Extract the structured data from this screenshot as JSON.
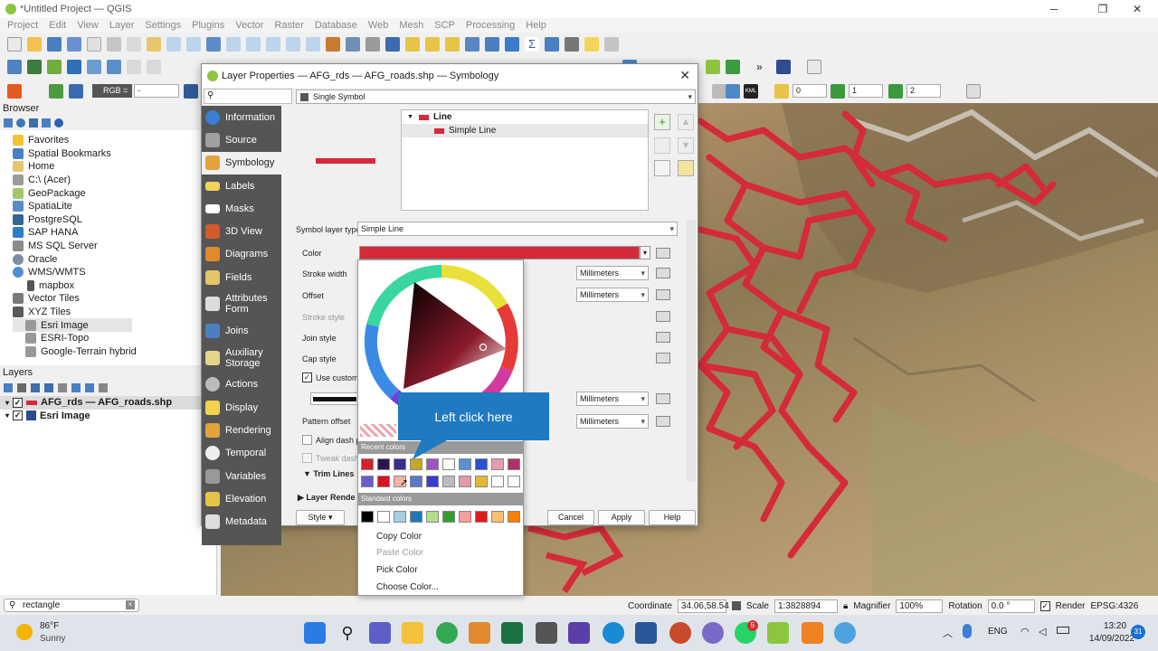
{
  "window": {
    "title": "*Untitled Project — QGIS"
  },
  "menu": [
    "Project",
    "Edit",
    "View",
    "Layer",
    "Settings",
    "Plugins",
    "Vector",
    "Raster",
    "Database",
    "Web",
    "Mesh",
    "SCP",
    "Processing",
    "Help"
  ],
  "toolbar3": {
    "rgb_label": "RGB =",
    "rgb_value": "-",
    "spin1": "0",
    "spin2": "1",
    "spin3": "2"
  },
  "browser": {
    "title": "Browser",
    "items": [
      "Favorites",
      "Spatial Bookmarks",
      "Home",
      "C:\\ (Acer)",
      "GeoPackage",
      "SpatiaLite",
      "PostgreSQL",
      "SAP HANA",
      "MS SQL Server",
      "Oracle",
      "WMS/WMTS",
      "mapbox",
      "Vector Tiles",
      "XYZ Tiles",
      "Esri Image",
      "ESRI-Topo",
      "Google-Terrain hybrid"
    ]
  },
  "layers": {
    "title": "Layers",
    "items": [
      "AFG_rds — AFG_roads.shp",
      "Esri Image"
    ]
  },
  "search": {
    "value": "rectangle"
  },
  "status": {
    "coordinate_label": "Coordinate",
    "coordinate": "34.06,58.54",
    "scale_label": "Scale",
    "scale": "1:3828894",
    "magnifier_label": "Magnifier",
    "magnifier": "100%",
    "rotation_label": "Rotation",
    "rotation": "0.0 °",
    "render": "Render",
    "crs": "EPSG:4326"
  },
  "dialog": {
    "title": "Layer Properties — AFG_rds — AFG_roads.shp — Symbology",
    "sidebar": [
      "Information",
      "Source",
      "Symbology",
      "Labels",
      "Masks",
      "3D View",
      "Diagrams",
      "Fields",
      "Attributes Form",
      "Joins",
      "Auxiliary Storage",
      "Actions",
      "Display",
      "Rendering",
      "Temporal",
      "Variables",
      "Elevation",
      "Metadata"
    ],
    "renderer": "Single Symbol",
    "tree_root": "Line",
    "tree_child": "Simple Line",
    "symbol_layer_type_label": "Symbol layer type",
    "symbol_layer_type": "Simple Line",
    "labels": {
      "color": "Color",
      "stroke_width": "Stroke width",
      "offset": "Offset",
      "stroke_style": "Stroke style",
      "join_style": "Join style",
      "cap_style": "Cap style",
      "use_custom": "Use custom",
      "pattern_offset": "Pattern offset",
      "align_dash": "Align dash p",
      "tweak_dash": "Tweak dash",
      "trim_lines": "Trim Lines",
      "layer_render": "Layer Rende"
    },
    "unit": "Millimeters",
    "buttons": {
      "style": "Style",
      "cancel": "Cancel",
      "apply": "Apply",
      "help": "Help"
    }
  },
  "picker": {
    "recent_label": "Recent colors",
    "standard_label": "Standard colors",
    "menu": [
      "Copy Color",
      "Paste Color",
      "Pick Color",
      "Choose Color..."
    ],
    "recent_row1": [
      "#d4212e",
      "#2b1450",
      "#3a2c8a",
      "#c9a726",
      "#9a55c2",
      "#ffffff",
      "#5a8fd6",
      "#2d4fd1",
      "#e89ab4",
      "#b0306a"
    ],
    "recent_row2": [
      "#6a5cd0",
      "#d81423",
      "#f3b3a2",
      "#5b77c7",
      "#3a3ad0",
      "#bcbcbc",
      "#e49aa9",
      "#e6b832",
      "#ffffff",
      "#ffffff"
    ],
    "standard": [
      "#000000",
      "#ffffff",
      "#a6cee3",
      "#1f78b4",
      "#b2df8a",
      "#33a02c",
      "#fb9a99",
      "#e31a1c",
      "#fdbf6f",
      "#ff7f00"
    ]
  },
  "tooltip": "Left click here",
  "taskbar": {
    "weather_temp": "86°F",
    "weather_desc": "Sunny",
    "lang": "ENG",
    "time": "13:20",
    "date": "14/09/2022",
    "whatsapp_badge": "5",
    "notif": "31"
  },
  "colors": {
    "accent": "#1f7ac2",
    "road": "#d42a3a"
  }
}
